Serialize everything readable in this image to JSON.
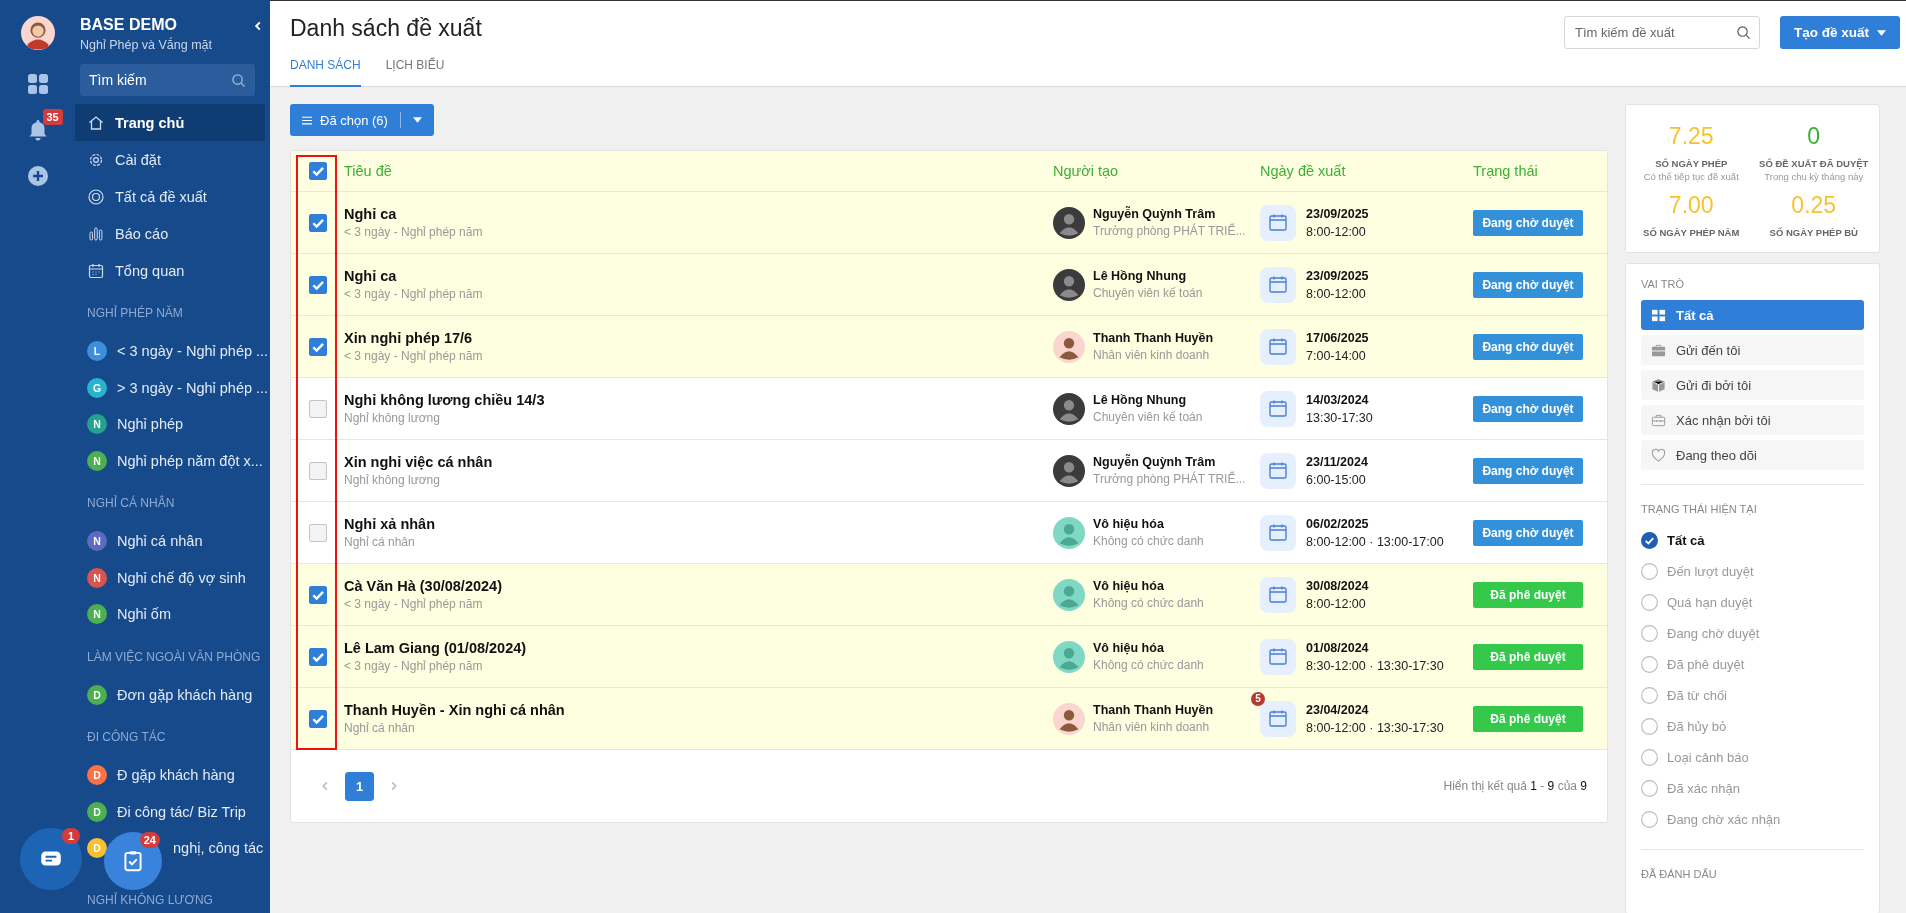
{
  "rail": {
    "notification_count": "35"
  },
  "sidebar": {
    "title": "BASE DEMO",
    "subtitle": "Nghỉ Phép và Vắng mặt",
    "search": {
      "placeholder": "Tìm kiếm"
    },
    "nav": [
      {
        "label": "Trang chủ",
        "selected": true
      },
      {
        "label": "Cài đặt",
        "selected": false
      },
      {
        "label": "Tất cả đề xuất",
        "selected": false
      },
      {
        "label": "Báo cáo",
        "selected": false
      },
      {
        "label": "Tổng quan",
        "selected": false
      }
    ],
    "groups": [
      {
        "heading": "NGHỈ PHÉP NĂM",
        "items": [
          {
            "letter": "L",
            "label": "< 3 ngày - Nghỉ phép ...",
            "color": "#3d8fdb"
          },
          {
            "letter": "G",
            "label": "> 3 ngày - Nghỉ phép ...",
            "color": "#27b4cc"
          },
          {
            "letter": "N",
            "label": "Nghỉ phép",
            "color": "#26a08f"
          },
          {
            "letter": "N",
            "label": "Nghỉ phép năm đột x...",
            "color": "#4caf50"
          }
        ]
      },
      {
        "heading": "NGHỈ CÁ NHÂN",
        "items": [
          {
            "letter": "N",
            "label": "Nghỉ cá nhân",
            "color": "#5c6bc0"
          },
          {
            "letter": "N",
            "label": "Nghỉ chế độ vợ sinh",
            "color": "#d9534f"
          },
          {
            "letter": "N",
            "label": "Nghỉ ốm",
            "color": "#4caf50"
          }
        ]
      },
      {
        "heading": "LÀM VIỆC NGOÀI VĂN PHÒNG",
        "items": [
          {
            "letter": "D",
            "label": "Đơn gặp khách hàng",
            "color": "#4caf50"
          }
        ]
      },
      {
        "heading": "ĐI CÔNG TÁC",
        "items": [
          {
            "letter": "D",
            "label": "Đ gặp khách hàng",
            "color": "#ff7043"
          },
          {
            "letter": "D",
            "label": "Đi công tác/ Biz Trip",
            "color": "#4caf50"
          },
          {
            "letter": "D",
            "label": "nghị, công tác",
            "color": "#fbc02d"
          }
        ]
      },
      {
        "heading": "NGHỈ KHÔNG LƯƠNG"
      }
    ]
  },
  "floating": [
    {
      "kind": "chat",
      "badge": "1"
    },
    {
      "kind": "tasks",
      "badge": "24"
    }
  ],
  "header": {
    "title": "Danh sách đề xuất",
    "tabs": [
      {
        "label": "DANH SÁCH",
        "selected": true
      },
      {
        "label": "LỊCH BIỂU",
        "selected": false
      }
    ],
    "search": {
      "placeholder": "Tìm kiếm đề xuất"
    },
    "create_button": "Tạo đề xuất"
  },
  "selection_button": "Đã chọn (6)",
  "table": {
    "all_checked": true,
    "columns": [
      "Tiêu đề",
      "Người tạo",
      "Ngày đề xuất",
      "Trạng thái"
    ],
    "rows": [
      {
        "checked": true,
        "title": "Nghỉ ca",
        "subtitle": "< 3 ngày - Nghỉ phép năm",
        "creator": "Nguyễn Quỳnh Trâm",
        "role": "Trưởng phòng PHÁT TRIỂ...",
        "avatar": {
          "kind": "dark"
        },
        "date": "23/09/2025",
        "time": "8:00-12:00",
        "status": {
          "label": "Đang chờ duyệt",
          "kind": "pending"
        }
      },
      {
        "checked": true,
        "title": "Nghỉ ca",
        "subtitle": "< 3 ngày - Nghỉ phép năm",
        "creator": "Lê Hồng Nhung",
        "role": "Chuyên viên kế toán",
        "avatar": {
          "kind": "dark"
        },
        "date": "23/09/2025",
        "time": "8:00-12:00",
        "status": {
          "label": "Đang chờ duyệt",
          "kind": "pending"
        }
      },
      {
        "checked": true,
        "title": "Xin nghỉ phép 17/6",
        "subtitle": "< 3 ngày - Nghỉ phép năm",
        "creator": "Thanh Thanh Huyền",
        "role": "Nhân viên kinh doanh",
        "avatar": {
          "kind": "illustration"
        },
        "date": "17/06/2025",
        "time": "7:00-14:00",
        "status": {
          "label": "Đang chờ duyệt",
          "kind": "pending"
        }
      },
      {
        "checked": false,
        "title": "Nghỉ không lương chiều 14/3",
        "subtitle": "Nghỉ không lương",
        "creator": "Lê Hồng Nhung",
        "role": "Chuyên viên kế toán",
        "avatar": {
          "kind": "dark"
        },
        "date": "14/03/2024",
        "time": "13:30-17:30",
        "status": {
          "label": "Đang chờ duyệt",
          "kind": "pending"
        }
      },
      {
        "checked": false,
        "title": "Xin nghỉ việc cá nhân",
        "subtitle": "Nghỉ không lương",
        "creator": "Nguyễn Quỳnh Trâm",
        "role": "Trưởng phòng PHÁT TRIỂ...",
        "avatar": {
          "kind": "dark"
        },
        "date": "23/11/2024",
        "time": "6:00-15:00",
        "status": {
          "label": "Đang chờ duyệt",
          "kind": "pending"
        }
      },
      {
        "checked": false,
        "title": "Nghỉ xả nhân",
        "subtitle": "Nghỉ cá nhân",
        "creator": "Vô hiệu hóa",
        "role": "Không có chức danh",
        "avatar": {
          "kind": "default"
        },
        "date": "06/02/2025",
        "time": "8:00-12:00 · 13:00-17:00",
        "status": {
          "label": "Đang chờ duyệt",
          "kind": "pending"
        }
      },
      {
        "checked": true,
        "title": "Cà Văn Hà (30/08/2024)",
        "subtitle": "< 3 ngày - Nghỉ phép năm",
        "creator": "Vô hiệu hóa",
        "role": "Không có chức danh",
        "avatar": {
          "kind": "default"
        },
        "date": "30/08/2024",
        "time": "8:00-12:00",
        "status": {
          "label": "Đã phê duyệt",
          "kind": "approved"
        }
      },
      {
        "checked": true,
        "title": "Lê Lam Giang (01/08/2024)",
        "subtitle": "< 3 ngày - Nghỉ phép năm",
        "creator": "Vô hiệu hóa",
        "role": "Không có chức danh",
        "avatar": {
          "kind": "default"
        },
        "date": "01/08/2024",
        "time": "8:30-12:00 · 13:30-17:30",
        "status": {
          "label": "Đã phê duyệt",
          "kind": "approved"
        }
      },
      {
        "checked": true,
        "title": "Thanh Huyền - Xin nghỉ cá nhân",
        "subtitle": "Nghỉ cá nhân",
        "creator": "Thanh Thanh Huyền",
        "role": "Nhân viên kinh doanh",
        "avatar": {
          "kind": "illustration"
        },
        "date": "23/04/2024",
        "time": "8:00-12:00 · 13:30-17:30",
        "status": {
          "label": "Đã phê duyệt",
          "kind": "approved"
        },
        "badge": "5"
      }
    ]
  },
  "pagination": {
    "pages": [
      {
        "label": "1",
        "selected": true
      }
    ],
    "summary": "Hiển thị kết quả **1** - **9** của **9**"
  },
  "stats": [
    {
      "value": "7.25",
      "label": "SỐ NGÀY PHÉP",
      "note": "Có thể tiếp tục đề xuất",
      "color": "#f7c231"
    },
    {
      "value": "0",
      "label": "SỐ ĐỀ XUẤT ĐÃ DUYỆT",
      "note": "Trong chu kỳ tháng này",
      "color": "#3cb034"
    },
    {
      "value": "7.00",
      "label": "SỐ NGÀY PHÉP NĂM",
      "color": "#f7c231"
    },
    {
      "value": "0.25",
      "label": "SỐ NGÀY PHÉP BÙ",
      "color": "#f7c231"
    }
  ],
  "roles": {
    "heading": "VAI TRÒ",
    "items": [
      {
        "label": "Tất cả",
        "selected": true
      },
      {
        "label": "Gửi đến tôi",
        "selected": false
      },
      {
        "label": "Gửi đi bởi tôi",
        "selected": false
      },
      {
        "label": "Xác nhận bởi tôi",
        "selected": false
      },
      {
        "label": "Đang theo dõi",
        "selected": false
      }
    ]
  },
  "statuses": {
    "heading": "TRẠNG THÁI HIỆN TẠI",
    "items": [
      {
        "label": "Tất cả",
        "selected": true
      },
      {
        "label": "Đến lượt duyệt",
        "selected": false
      },
      {
        "label": "Quá hạn duyệt",
        "selected": false
      },
      {
        "label": "Đang chờ duyệt",
        "selected": false
      },
      {
        "label": "Đã phê duyệt",
        "selected": false
      },
      {
        "label": "Đã từ chối",
        "selected": false
      },
      {
        "label": "Đã hủy bỏ",
        "selected": false
      },
      {
        "label": "Loại cảnh báo",
        "selected": false
      },
      {
        "label": "Đã xác nhận",
        "selected": false
      },
      {
        "label": "Đang chờ xác nhận",
        "selected": false
      }
    ]
  },
  "marked": {
    "heading": "ĐÃ ĐÁNH DẤU"
  }
}
